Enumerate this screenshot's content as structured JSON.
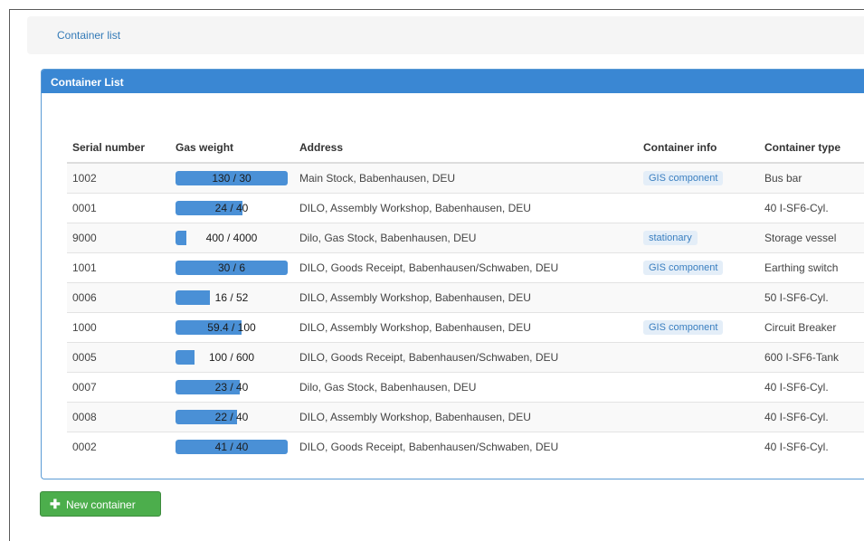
{
  "breadcrumb": {
    "label": "Container list"
  },
  "panel": {
    "title": "Container List"
  },
  "table": {
    "headers": [
      "Serial number",
      "Gas weight",
      "Address",
      "Container info",
      "Container type"
    ],
    "rows": [
      {
        "serial": "1002",
        "gas": "130 / 30",
        "gas_fill_pct": 100,
        "address": "Main Stock, Babenhausen, DEU",
        "info": "GIS component",
        "type": "Bus bar"
      },
      {
        "serial": "0001",
        "gas": "24 / 40",
        "gas_fill_pct": 60,
        "address": "DILO, Assembly Workshop, Babenhausen, DEU",
        "info": "",
        "type": "40 I-SF6-Cyl."
      },
      {
        "serial": "9000",
        "gas": "400 / 4000",
        "gas_fill_pct": 10,
        "address": "Dilo, Gas Stock, Babenhausen, DEU",
        "info": "stationary",
        "type": "Storage vessel"
      },
      {
        "serial": "1001",
        "gas": "30 / 6",
        "gas_fill_pct": 100,
        "address": "DILO, Goods Receipt, Babenhausen/Schwaben, DEU",
        "info": "GIS component",
        "type": "Earthing switch"
      },
      {
        "serial": "0006",
        "gas": "16 / 52",
        "gas_fill_pct": 31,
        "address": "DILO, Assembly Workshop, Babenhausen, DEU",
        "info": "",
        "type": "50 I-SF6-Cyl."
      },
      {
        "serial": "1000",
        "gas": "59.4 / 100",
        "gas_fill_pct": 59,
        "address": "DILO, Assembly Workshop, Babenhausen, DEU",
        "info": "GIS component",
        "type": "Circuit Breaker"
      },
      {
        "serial": "0005",
        "gas": "100 / 600",
        "gas_fill_pct": 17,
        "address": "DILO, Goods Receipt, Babenhausen/Schwaben, DEU",
        "info": "",
        "type": "600 I-SF6-Tank"
      },
      {
        "serial": "0007",
        "gas": "23 / 40",
        "gas_fill_pct": 57,
        "address": "Dilo, Gas Stock, Babenhausen, DEU",
        "info": "",
        "type": "40 I-SF6-Cyl."
      },
      {
        "serial": "0008",
        "gas": "22 / 40",
        "gas_fill_pct": 55,
        "address": "DILO, Assembly Workshop, Babenhausen, DEU",
        "info": "",
        "type": "40 I-SF6-Cyl."
      },
      {
        "serial": "0002",
        "gas": "41 / 40",
        "gas_fill_pct": 100,
        "address": "DILO, Goods Receipt, Babenhausen/Schwaben, DEU",
        "info": "",
        "type": "40 I-SF6-Cyl."
      }
    ]
  },
  "actions": {
    "new_container_label": "New container",
    "new_container_icon": "plus-icon"
  },
  "colors": {
    "primary": "#3a87d3",
    "gauge": "#4a90d6",
    "success": "#4cae4c",
    "link": "#337ab7"
  }
}
